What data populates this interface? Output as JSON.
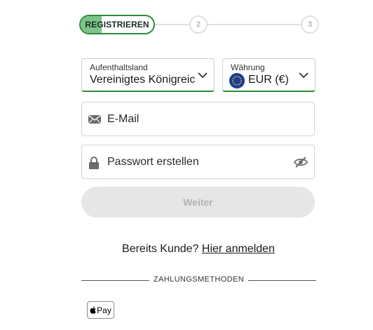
{
  "stepper": {
    "step1_label": "REGISTRIEREN",
    "step2_number": "2",
    "step3_number": "3",
    "step1_progress_percent": 28
  },
  "country_select": {
    "label": "Aufenthaltsland",
    "value": "Vereinigtes Königreic"
  },
  "currency_select": {
    "label": "Währung",
    "value": "EUR (€)",
    "flag_icon": "eu-flag-icon"
  },
  "email_input": {
    "placeholder": "E-Mail",
    "icon": "envelope-icon"
  },
  "password_input": {
    "placeholder": "Passwort erstellen",
    "icon": "lock-icon",
    "toggle_icon": "eye-slash-icon"
  },
  "submit": {
    "label": "Weiter"
  },
  "login": {
    "prompt": "Bereits Kunde?",
    "link_text": "Hier anmelden"
  },
  "payment": {
    "heading": "ZAHLUNGSMETHODEN",
    "methods": [
      {
        "label": "Pay",
        "icon": "apple-icon"
      }
    ]
  },
  "colors": {
    "accent_green": "#2e8b3a",
    "step_fill_green": "#7cc48a",
    "eu_blue": "#1f3d99",
    "eu_star_yellow": "#ffd200",
    "disabled_button": "#e6e6e6"
  }
}
